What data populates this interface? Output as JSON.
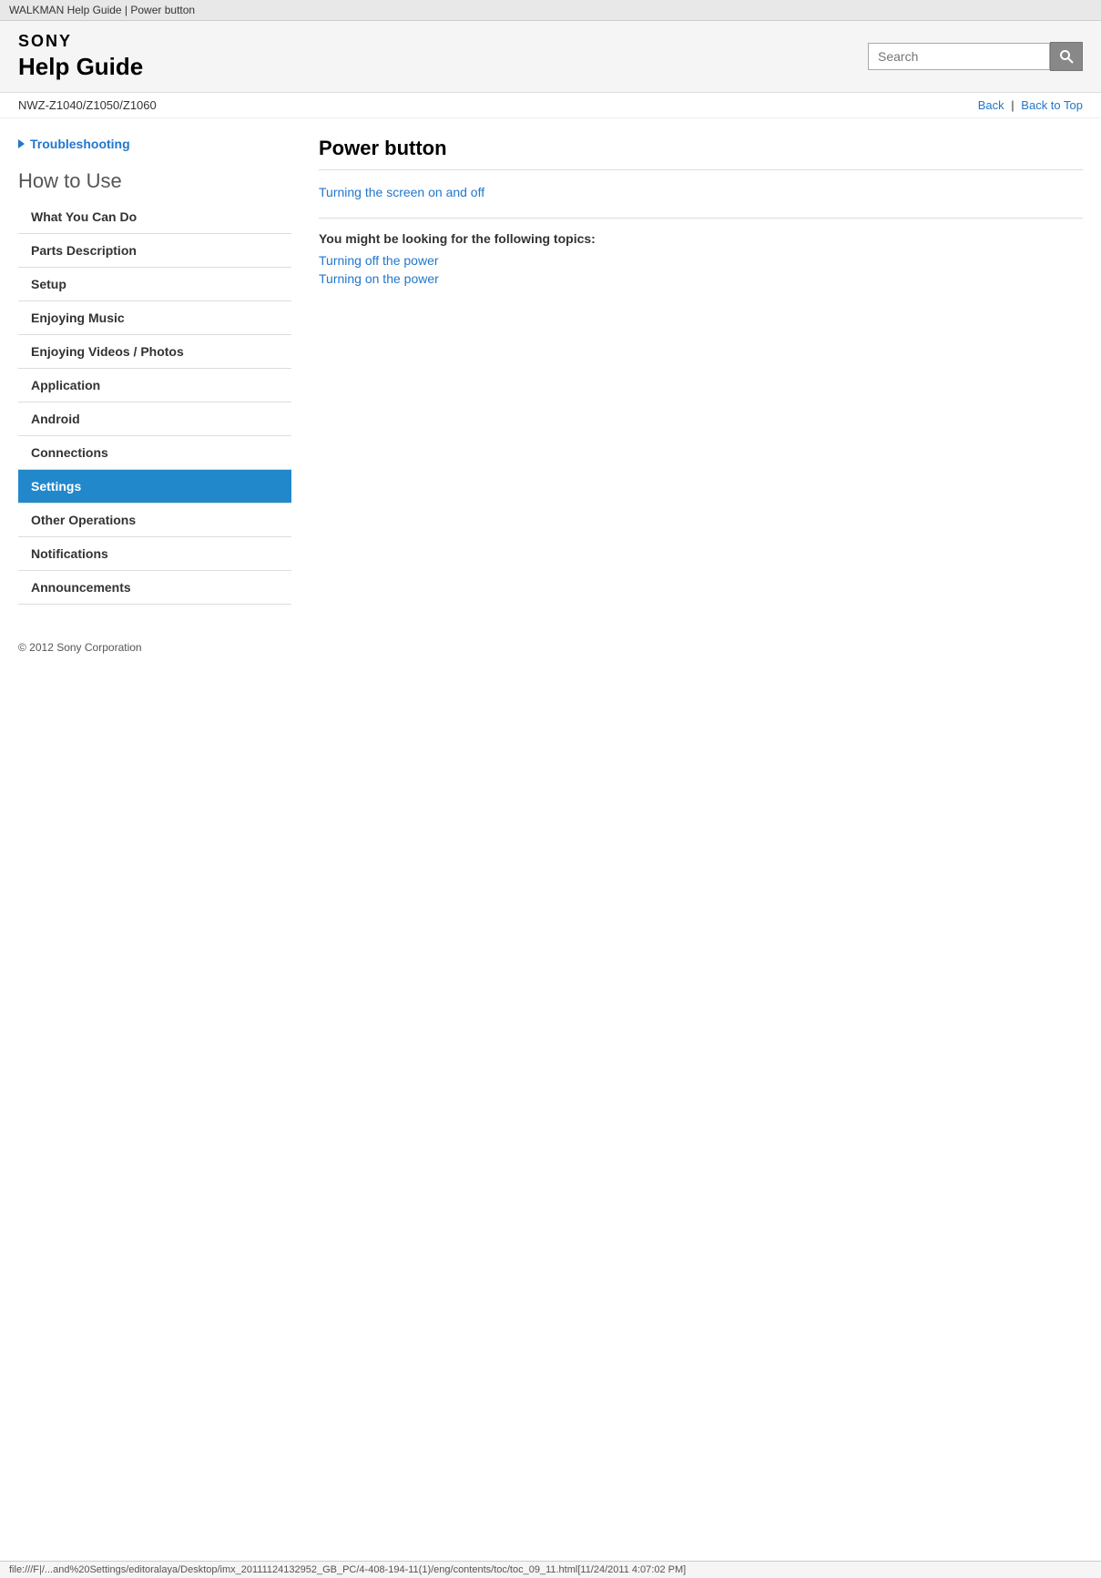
{
  "browser_tab": {
    "title": "WALKMAN Help Guide | Power button"
  },
  "header": {
    "sony_logo": "SONY",
    "help_guide_title": "Help Guide",
    "search": {
      "placeholder": "Search",
      "button_label": ""
    }
  },
  "nav": {
    "model_number": "NWZ-Z1040/Z1050/Z1060",
    "back_label": "Back",
    "back_to_top_label": "Back to Top",
    "separator": "|"
  },
  "sidebar": {
    "troubleshooting_label": "Troubleshooting",
    "how_to_use_label": "How to Use",
    "items": [
      {
        "label": "What You Can Do",
        "active": false
      },
      {
        "label": "Parts Description",
        "active": false
      },
      {
        "label": "Setup",
        "active": false
      },
      {
        "label": "Enjoying Music",
        "active": false
      },
      {
        "label": "Enjoying Videos / Photos",
        "active": false
      },
      {
        "label": "Application",
        "active": false
      },
      {
        "label": "Android",
        "active": false
      },
      {
        "label": "Connections",
        "active": false
      },
      {
        "label": "Settings",
        "active": true
      },
      {
        "label": "Other Operations",
        "active": false
      },
      {
        "label": "Notifications",
        "active": false
      },
      {
        "label": "Announcements",
        "active": false
      }
    ]
  },
  "main": {
    "page_heading": "Power button",
    "main_link": "Turning the screen on and off",
    "you_might_label": "You might be looking for the following topics:",
    "topic_links": [
      {
        "label": "Turning off the power"
      },
      {
        "label": "Turning on the power"
      }
    ]
  },
  "footer": {
    "copyright": "© 2012 Sony Corporation"
  },
  "bottom_bar": {
    "path": "file:///F|/...and%20Settings/editoralaya/Desktop/imx_20111124132952_GB_PC/4-408-194-11(1)/eng/contents/toc/toc_09_11.html[11/24/2011 4:07:02 PM]"
  }
}
